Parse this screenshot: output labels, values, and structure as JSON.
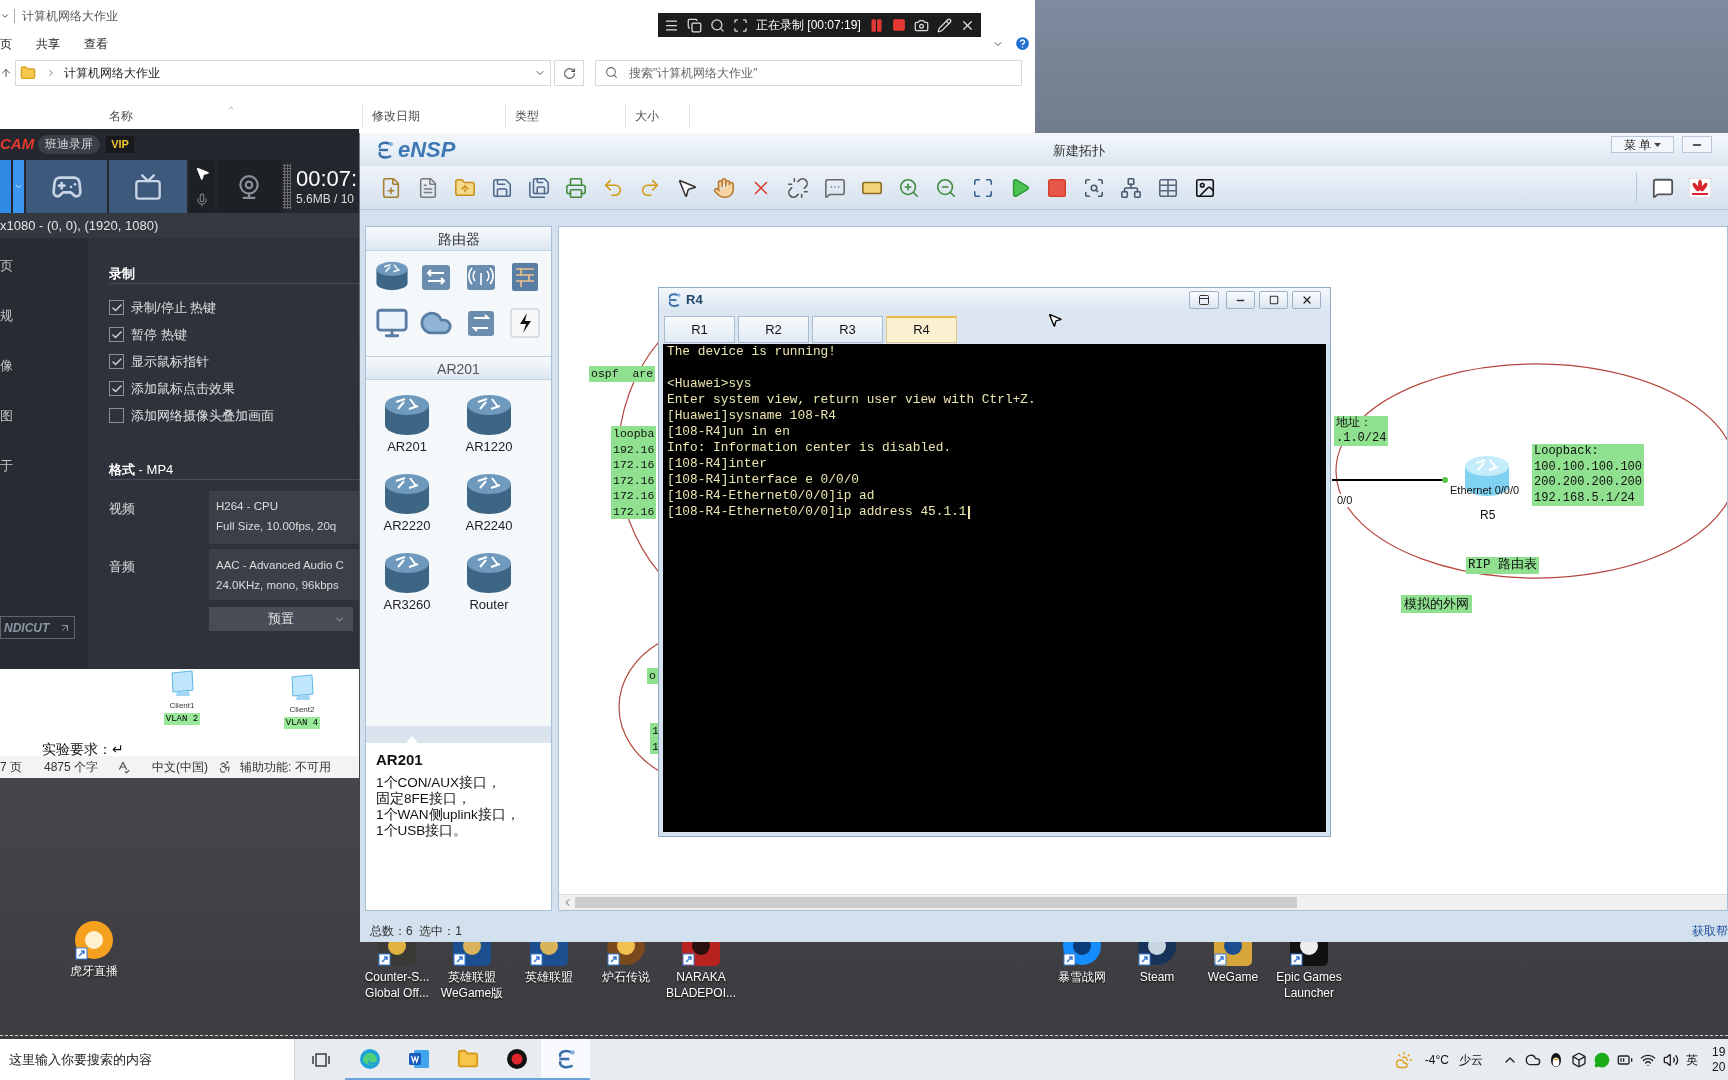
{
  "explorer": {
    "title": "计算机网络大作业",
    "ribbon_tabs": [
      {
        "label": "页",
        "selected": false
      },
      {
        "label": "共享",
        "selected": false
      },
      {
        "label": "查看",
        "selected": false
      }
    ],
    "path": "计算机网络大作业",
    "search": {
      "placeholder": "搜索\"计算机网络大作业\""
    },
    "columns": [
      {
        "label": "名称",
        "sorted": true
      },
      {
        "label": "修改日期",
        "sorted": false
      },
      {
        "label": "类型",
        "sorted": false
      },
      {
        "label": "大小",
        "sorted": false
      }
    ]
  },
  "recording_bar": {
    "status": "正在录制 [00:07:19]"
  },
  "bandicam": {
    "logo": "CAM",
    "name": "班迪录屏",
    "badge": "VIP",
    "modes": [
      {
        "kind": "screen",
        "selected": true
      },
      {
        "kind": "game",
        "selected": false
      },
      {
        "kind": "device",
        "selected": false
      }
    ],
    "timer": "00:07:",
    "file_size": "5.6MB / 10",
    "region": "x1080 - (0, 0), (1920, 1080)",
    "nav": [
      {
        "label": "页",
        "selected": false
      },
      {
        "label": "规",
        "selected": false
      },
      {
        "label": "像",
        "selected": false
      },
      {
        "label": "图",
        "selected": false
      },
      {
        "label": "于",
        "selected": false
      }
    ],
    "section": "录制",
    "options": [
      {
        "label": "录制/停止 热键",
        "checked": true
      },
      {
        "label": "暂停 热键",
        "checked": true
      },
      {
        "label": "显示鼠标指针",
        "checked": true
      },
      {
        "label": "添加鼠标点击效果",
        "checked": true
      },
      {
        "label": "添加网络摄像头叠加画面",
        "checked": false
      }
    ],
    "format": "**格式** - MP4",
    "video": {
      "label": "视频",
      "codec": "H264 - CPU",
      "settings": "Full Size, 10.00fps, 20q"
    },
    "audio": {
      "label": "音频",
      "codec": "AAC - Advanced Audio C",
      "settings": "24.0KHz, mono, 96kbps"
    },
    "preset": "预置",
    "bandicut": "NDICUT"
  },
  "word": {
    "clients": [
      {
        "name": "Client1",
        "vlan": "VLAN 2"
      },
      {
        "name": "Client2",
        "vlan": "VLAN 4"
      }
    ],
    "text": "实验要求：↵",
    "status": [
      "7 页",
      "4875 个字",
      "中文(中国)",
      "辅助功能: 不可用"
    ]
  },
  "ensp": {
    "logo": "eNSP",
    "title": "新建拓扑",
    "menu": "菜 单",
    "palette": {
      "category": "路由器",
      "category_icons": [
        {
          "kind": "router"
        },
        {
          "kind": "switch"
        },
        {
          "kind": "wireless"
        },
        {
          "kind": "firewall"
        },
        {
          "kind": "pc"
        },
        {
          "kind": "cloud"
        },
        {
          "kind": "hub"
        },
        {
          "kind": "cable"
        }
      ],
      "series": "AR201",
      "models": [
        {
          "name": "AR201"
        },
        {
          "name": "AR1220"
        },
        {
          "name": "AR2220"
        },
        {
          "name": "AR2240"
        },
        {
          "name": "AR3260"
        },
        {
          "name": "Router"
        }
      ],
      "description": {
        "title": "AR201",
        "lines": [
          "1个CON/AUX接口，",
          "固定8FE接口，",
          "1个WAN侧uplink接口，",
          "1个USB接口。"
        ]
      }
    },
    "canvas": {
      "left_tags": [
        {
          "lines": [
            "ospf  are"
          ]
        },
        {
          "lines": [
            "loopba",
            "192.16",
            "172.16",
            "172.16",
            "172.16",
            "172.16"
          ]
        },
        {
          "lines": [
            "o"
          ]
        },
        {
          "lines": [
            "1",
            "1"
          ]
        }
      ],
      "address_tag": [
        "地址：",
        ".1.0/24"
      ],
      "port_label": "0/0",
      "router": {
        "name": "R5",
        "port": "Ethernet 0/0/0"
      },
      "loopback_tag": [
        "Loopback:",
        "100.100.100.100",
        "200.200.200.200",
        "192.168.5.1/24"
      ],
      "rip_tag": "RIP 路由表",
      "external_tag": "模拟的外网"
    },
    "status": "总数：6  选中：1",
    "help_link": "获取帮"
  },
  "terminal": {
    "title": "R4",
    "tabs": [
      {
        "label": "R1",
        "selected": false
      },
      {
        "label": "R2",
        "selected": false
      },
      {
        "label": "R3",
        "selected": false
      },
      {
        "label": "R4",
        "selected": true
      }
    ],
    "blocks": [
      {
        "lines": [
          "The device is running!"
        ]
      },
      {
        "lines": [
          "<Huawei>sys",
          "Enter system view, return user view with Ctrl+Z.",
          "[Huawei]sysname 108-R4",
          "[108-R4]un in en",
          "Info: Information center is disabled.",
          "[108-R4]inter",
          "[108-R4]interface e 0/0/0",
          "[108-R4-Ethernet0/0/0]ip ad",
          "[108-R4-Ethernet0/0/0]ip address 45.1.1"
        ]
      }
    ],
    "cursor": true
  },
  "desktop_icons": [
    {
      "kind": "huya",
      "lines": [
        "虎牙直播"
      ]
    },
    {
      "kind": "csgo",
      "lines": [
        "Counter-S...",
        "Global Off..."
      ]
    },
    {
      "kind": "lol",
      "lines": [
        "英雄联盟",
        "WeGame版"
      ]
    },
    {
      "kind": "lol",
      "lines": [
        "英雄联盟"
      ]
    },
    {
      "kind": "hearthstone",
      "lines": [
        "炉石传说"
      ]
    },
    {
      "kind": "naraka",
      "lines": [
        "NARAKA",
        "BLADEPOI..."
      ]
    },
    {
      "kind": "battlenet",
      "lines": [
        "暴雪战网"
      ]
    },
    {
      "kind": "steam",
      "lines": [
        "Steam"
      ]
    },
    {
      "kind": "wegame",
      "lines": [
        "WeGame"
      ]
    },
    {
      "kind": "epic",
      "lines": [
        "Epic Games",
        "Launcher"
      ]
    }
  ],
  "taskbar": {
    "search": {
      "placeholder": "这里输入你要搜索的内容"
    },
    "apps": [
      {
        "kind": "task_view",
        "running": false,
        "selected": false
      },
      {
        "kind": "browser",
        "running": true,
        "selected": false
      },
      {
        "kind": "word",
        "running": true,
        "selected": false
      },
      {
        "kind": "explorer",
        "running": true,
        "selected": false
      },
      {
        "kind": "recorder",
        "running": true,
        "selected": false
      },
      {
        "kind": "ensp",
        "running": true,
        "selected": true
      }
    ],
    "weather": {
      "temperature": "-4°C",
      "condition": "少云"
    },
    "ime": "英",
    "clock": [
      "19",
      "20"
    ]
  }
}
